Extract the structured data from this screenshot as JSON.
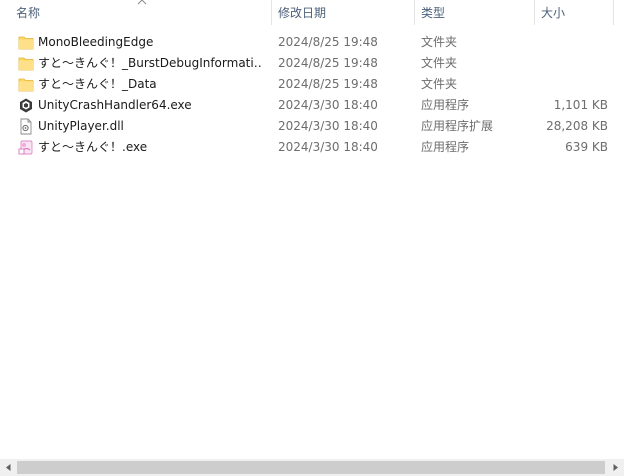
{
  "header": {
    "name": "名称",
    "date": "修改日期",
    "type": "类型",
    "size": "大小"
  },
  "files": [
    {
      "icon": "folder-icon",
      "name": "MonoBleedingEdge",
      "date": "2024/8/25 19:48",
      "type": "文件夹",
      "size": ""
    },
    {
      "icon": "folder-icon",
      "name": "すと～きんぐ！_BurstDebugInformati…",
      "date": "2024/8/25 19:48",
      "type": "文件夹",
      "size": ""
    },
    {
      "icon": "folder-icon",
      "name": "すと～きんぐ！_Data",
      "date": "2024/8/25 19:48",
      "type": "文件夹",
      "size": ""
    },
    {
      "icon": "unity-app-icon",
      "name": "UnityCrashHandler64.exe",
      "date": "2024/3/30 18:40",
      "type": "应用程序",
      "size": "1,101 KB"
    },
    {
      "icon": "dll-file-icon",
      "name": "UnityPlayer.dll",
      "date": "2024/3/30 18:40",
      "type": "应用程序扩展",
      "size": "28,208 KB"
    },
    {
      "icon": "game-exe-icon",
      "name": "すと～きんぐ！.exe",
      "date": "2024/3/30 18:40",
      "type": "应用程序",
      "size": "639 KB"
    }
  ]
}
